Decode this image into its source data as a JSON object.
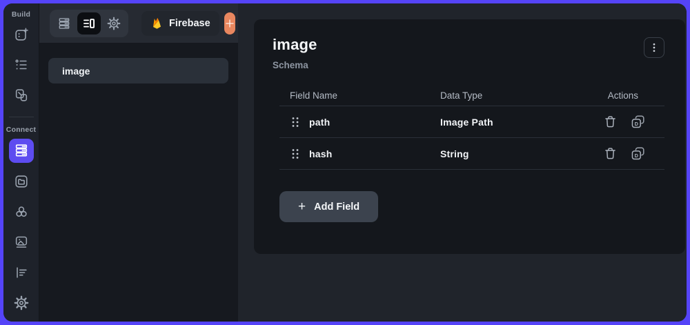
{
  "window": {
    "frame_color": "#5544f8",
    "accent_purple": "#5d4cf0",
    "accent_orange": "#e9875f"
  },
  "sidebar": {
    "build_label": "Build",
    "connect_label": "Connect"
  },
  "collections_panel": {
    "firebase_button_label": "Firebase",
    "collections": [
      {
        "name": "image"
      }
    ]
  },
  "main": {
    "collection_title": "image",
    "section_label": "Schema",
    "table": {
      "headers": {
        "field_name": "Field Name",
        "data_type": "Data Type",
        "actions": "Actions"
      },
      "rows": [
        {
          "field_name": "path",
          "data_type": "Image Path"
        },
        {
          "field_name": "hash",
          "data_type": "String"
        }
      ]
    },
    "add_field_button_label": "Add Field",
    "add_field_plus": "+"
  },
  "icons": {
    "sidebar_build": [
      "widget-add-icon",
      "checklist-icon",
      "pages-icon"
    ],
    "sidebar_connect": [
      "database-icon",
      "file-icon",
      "integrations-icon",
      "media-icon",
      "logs-icon",
      "settings-icon"
    ],
    "toolbar": [
      "table-view-icon",
      "schema-view-icon",
      "collection-settings-icon",
      "firebase-icon",
      "add-collection-plus-icon"
    ],
    "row_actions": [
      "drag-handle-icon",
      "delete-icon",
      "duplicate-icon"
    ],
    "card_header": [
      "kebab-menu-icon"
    ]
  }
}
